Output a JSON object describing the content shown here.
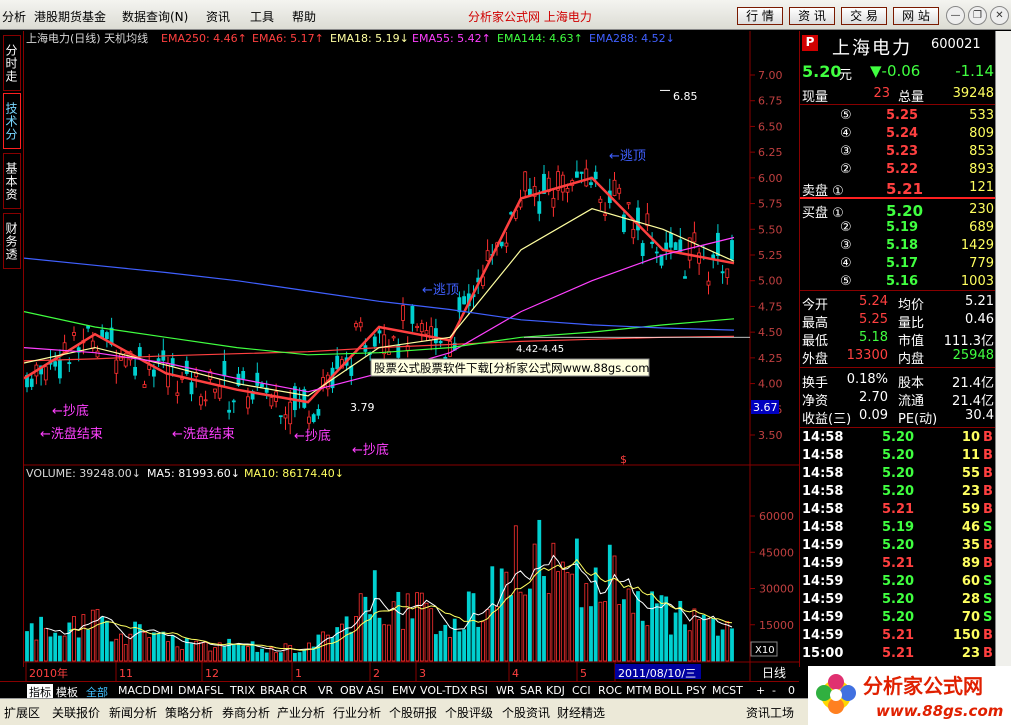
{
  "menu": {
    "items": [
      "分析",
      "港股期货基金",
      "数据查询(N)",
      "资讯",
      "工具",
      "帮助"
    ],
    "center_title": "分析家公式网 上海电力",
    "buttons": [
      "行 情",
      "资 讯",
      "交 易",
      "网 站"
    ]
  },
  "left_tabs": [
    "分时走势",
    "技术分析",
    "基本资料",
    "财务透视"
  ],
  "chart": {
    "title": "上海电力(日线) 天机均线",
    "ema_labels": [
      {
        "text": "EMA250: 4.46↑",
        "color": "#ff4040"
      },
      {
        "text": "EMA6: 5.17↑",
        "color": "#ff4040"
      },
      {
        "text": "EMA18: 5.19↓",
        "color": "#ffffa0"
      },
      {
        "text": "EMA55: 5.42↑",
        "color": "#ff40ff"
      },
      {
        "text": "EMA144: 4.63↑",
        "color": "#40ff40"
      },
      {
        "text": "EMA288: 4.52↓",
        "color": "#4060ff"
      }
    ],
    "price_ticks": [
      "7.00",
      "6.75",
      "6.50",
      "6.25",
      "6.00",
      "5.75",
      "5.50",
      "5.25",
      "5.00",
      "4.75",
      "4.50",
      "4.25",
      "4.00",
      "3.75",
      "3.50"
    ],
    "current_price_tag": "3.67",
    "annotations": {
      "high": "6.85",
      "low": "3.79",
      "range": "4.42-4.45",
      "escape_top_1": "←逃顶",
      "escape_top_2": "←逃顶",
      "bottom_1": "←抄底",
      "wash_1": "←洗盘结束",
      "wash_2": "←洗盘结束",
      "bottom_2": "←抄底",
      "bottom_3": "←抄底",
      "dollar": "$"
    },
    "banner": "股票公式股票软件下载[分析家公式网www.88gs.com]",
    "volume_header": {
      "vol": "VOLUME: 39248.00↓",
      "ma5": "MA5: 81993.60↓",
      "ma10": "MA10: 86174.40↓"
    },
    "vol_ticks": [
      "60000",
      "45000",
      "30000",
      "15000"
    ],
    "vol_unit": "X10",
    "time_labels": [
      "2010年",
      "11",
      "12",
      "1",
      "2",
      "3",
      "4",
      "5",
      "2011/08/10/三"
    ],
    "period": "日线",
    "zoom_buttons": [
      "+",
      "-",
      "0"
    ]
  },
  "chart_data": {
    "type": "line",
    "title": "上海电力(日线) 天机均线",
    "ylim": [
      3.4,
      7.1
    ],
    "x": [
      "2010-10",
      "2010-11",
      "2010-12",
      "2011-01",
      "2011-02",
      "2011-03",
      "2011-04",
      "2011-05",
      "2011-06",
      "2011-07",
      "2011-08"
    ],
    "series": [
      {
        "name": "EMA250",
        "values": [
          4.22,
          4.24,
          4.27,
          4.29,
          4.31,
          4.35,
          4.38,
          4.41,
          4.43,
          4.45,
          4.46
        ]
      },
      {
        "name": "EMA6",
        "values": [
          4.05,
          4.48,
          4.1,
          3.94,
          3.82,
          4.55,
          4.42,
          5.8,
          6.0,
          5.3,
          5.17
        ]
      },
      {
        "name": "EMA18",
        "values": [
          4.2,
          4.35,
          4.18,
          4.0,
          3.88,
          4.35,
          4.45,
          5.3,
          5.7,
          5.5,
          5.19
        ]
      },
      {
        "name": "EMA55",
        "values": [
          4.35,
          4.3,
          4.2,
          4.05,
          3.92,
          4.1,
          4.3,
          4.7,
          5.0,
          5.25,
          5.42
        ]
      },
      {
        "name": "EMA144",
        "values": [
          4.7,
          4.55,
          4.45,
          4.35,
          4.28,
          4.3,
          4.35,
          4.45,
          4.5,
          4.57,
          4.63
        ]
      },
      {
        "name": "EMA288",
        "values": [
          5.22,
          5.15,
          5.08,
          5.0,
          4.9,
          4.8,
          4.72,
          4.62,
          4.57,
          4.54,
          4.52
        ]
      }
    ]
  },
  "quote": {
    "flag": "P",
    "name": "上海电力",
    "code": "600021",
    "price": "5.20",
    "price_unit": "元",
    "change": "▼-0.06",
    "pct": "-1.14",
    "xianliang_label": "现量",
    "xianliang": "23",
    "zongliang_label": "总量",
    "zongliang": "39248",
    "sell": [
      {
        "label": "⑤",
        "price": "5.25",
        "vol": "533"
      },
      {
        "label": "④",
        "price": "5.24",
        "vol": "809"
      },
      {
        "label": "③",
        "price": "5.23",
        "vol": "853"
      },
      {
        "label": "②",
        "price": "5.22",
        "vol": "893"
      },
      {
        "label": "卖盘 ①",
        "price": "5.21",
        "vol": "121"
      }
    ],
    "buy": [
      {
        "label": "买盘 ①",
        "price": "5.20",
        "vol": "230"
      },
      {
        "label": "②",
        "price": "5.19",
        "vol": "689"
      },
      {
        "label": "③",
        "price": "5.18",
        "vol": "1429"
      },
      {
        "label": "④",
        "price": "5.17",
        "vol": "779"
      },
      {
        "label": "⑤",
        "price": "5.16",
        "vol": "1003"
      }
    ],
    "stats": [
      {
        "l1": "今开",
        "v1": "5.24",
        "l2": "均价",
        "v2": "5.21",
        "c1": "#ff4040",
        "c2": "#ffffff"
      },
      {
        "l1": "最高",
        "v1": "5.25",
        "l2": "量比",
        "v2": "0.46",
        "c1": "#ff4040",
        "c2": "#ffffff"
      },
      {
        "l1": "最低",
        "v1": "5.18",
        "l2": "市值",
        "v2": "111.3亿",
        "c1": "#40ff40",
        "c2": "#ffffff"
      },
      {
        "l1": "外盘",
        "v1": "13300",
        "l2": "内盘",
        "v2": "25948",
        "c1": "#ff4040",
        "c2": "#40ff40"
      }
    ],
    "stats2": [
      {
        "l1": "换手",
        "v1": "0.18%",
        "l2": "股本",
        "v2": "21.4亿"
      },
      {
        "l1": "净资",
        "v1": "2.70",
        "l2": "流通",
        "v2": "21.4亿"
      },
      {
        "l1": "收益(三)",
        "v1": "0.09",
        "l2": "PE(动)",
        "v2": "30.4"
      }
    ],
    "ticks": [
      {
        "t": "14:58",
        "p": "5.20",
        "v": "10",
        "d": "B"
      },
      {
        "t": "14:58",
        "p": "5.20",
        "v": "11",
        "d": "B"
      },
      {
        "t": "14:58",
        "p": "5.20",
        "v": "55",
        "d": "B"
      },
      {
        "t": "14:58",
        "p": "5.20",
        "v": "23",
        "d": "B"
      },
      {
        "t": "14:58",
        "p": "5.21",
        "v": "59",
        "d": "B"
      },
      {
        "t": "14:58",
        "p": "5.19",
        "v": "46",
        "d": "S"
      },
      {
        "t": "14:59",
        "p": "5.20",
        "v": "35",
        "d": "B"
      },
      {
        "t": "14:59",
        "p": "5.21",
        "v": "89",
        "d": "B"
      },
      {
        "t": "14:59",
        "p": "5.20",
        "v": "60",
        "d": "S"
      },
      {
        "t": "14:59",
        "p": "5.20",
        "v": "28",
        "d": "S"
      },
      {
        "t": "14:59",
        "p": "5.20",
        "v": "70",
        "d": "S"
      },
      {
        "t": "14:59",
        "p": "5.21",
        "v": "150",
        "d": "B"
      },
      {
        "t": "15:00",
        "p": "5.21",
        "v": "23",
        "d": "B"
      }
    ]
  },
  "indicators": [
    "指标",
    "模板",
    "全部",
    "MACD",
    "DMI",
    "DMA",
    "FSL",
    "TRIX",
    "BRAR",
    "CR",
    "VR",
    "OBV",
    "ASI",
    "EMV",
    "VOL-TDX",
    "RSI",
    "WR",
    "SAR",
    "KDJ",
    "CCI",
    "ROC",
    "MTM",
    "BOLL",
    "PSY",
    "MCST"
  ],
  "bottom": [
    "扩展区",
    "关联报价",
    "新闻分析",
    "策略分析",
    "券商分析",
    "产业分析",
    "行业分析",
    "个股研报",
    "个股评级",
    "个股资讯",
    "财经精选",
    "资讯工场"
  ],
  "logo": {
    "name": "分析家公式网",
    "url": "www.88gs.com"
  }
}
